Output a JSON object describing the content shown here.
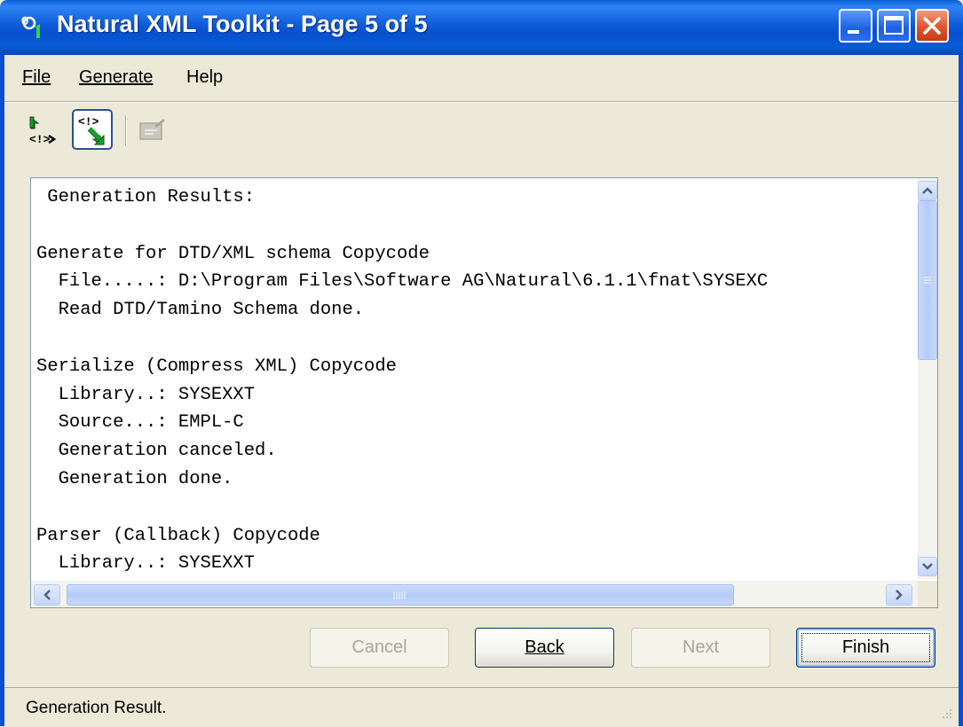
{
  "window": {
    "title": "Natural XML Toolkit - Page 5 of 5"
  },
  "menu": {
    "file": "File",
    "generate": "Generate",
    "help": "Help"
  },
  "toolbar": {
    "icons": [
      "xml-to-natural-icon",
      "natural-to-xml-icon",
      "edit-disabled-icon"
    ]
  },
  "results": {
    "lines": [
      " Generation Results:",
      "",
      "Generate for DTD/XML schema Copycode",
      "  File.....: D:\\Program Files\\Software AG\\Natural\\6.1.1\\fnat\\SYSEXC",
      "  Read DTD/Tamino Schema done.",
      "",
      "Serialize (Compress XML) Copycode",
      "  Library..: SYSEXXT",
      "  Source...: EMPL-C",
      "  Generation canceled.",
      "  Generation done.",
      "",
      "Parser (Callback) Copycode",
      "  Library..: SYSEXXT"
    ]
  },
  "buttons": {
    "cancel": "Cancel",
    "back": "Back",
    "next": "Next",
    "finish": "Finish"
  },
  "status": {
    "text": "Generation Result."
  },
  "colors": {
    "titlebar": "#0a5bd6",
    "window_bg": "#ece9d8",
    "scroll_thumb": "#b4cbf9"
  }
}
